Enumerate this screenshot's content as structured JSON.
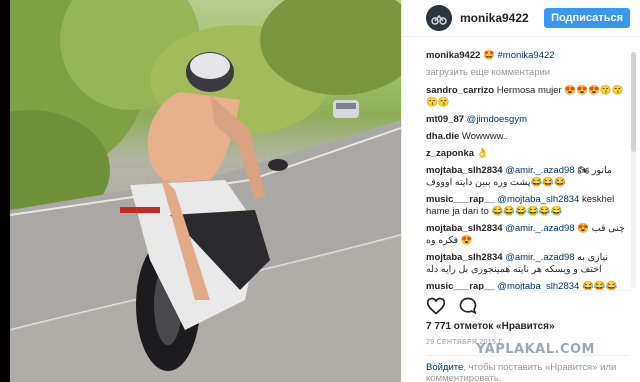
{
  "post": {
    "header_username": "monika9422",
    "follow_label": "Подписаться",
    "caption_user": "monika9422",
    "caption_text": "🤩 #monika9422",
    "load_more": "загрузить еще комментарии",
    "likes": "7 771 отметок «Нравится»",
    "date": "29 СЕНТЯБРЯ 2015 Г.",
    "login_link": "Войдите",
    "login_text": ", чтобы поставить «Нравится» или комментировать."
  },
  "comments": [
    {
      "user": "sandro_carrizo",
      "mention": "",
      "text": "Hermosa mujer 😍😍😍😙😙😙😙",
      "rtl": false
    },
    {
      "user": "mt09_87",
      "mention": "@jimdoesgym",
      "text": "",
      "rtl": false
    },
    {
      "user": "dha.die",
      "mention": "",
      "text": "Wowwww..",
      "rtl": false
    },
    {
      "user": "z_zaponka",
      "mention": "",
      "text": "👌",
      "rtl": false
    },
    {
      "user": "mojtaba_slh2834",
      "mention": "@amir._.azad98",
      "text": "مانور 🏍 پشت وره ببین دایته اوووف😂😂😂",
      "rtl": false
    },
    {
      "user": "music___rap__",
      "mention": "@mojtaba_slh2834",
      "text": "keskhel hame ja dari to 😂😂😂😂😂😂",
      "rtl": false
    },
    {
      "user": "mojtaba_slh2834",
      "mention": "@amir._.azad98",
      "text": "چنی قب 😍 فکره وه 😍",
      "rtl": false
    },
    {
      "user": "mojtaba_slh2834",
      "mention": "@amir._.azad98",
      "text": "نیازی به اختف و ویسکه هر نایته همینجوری بل رایه دله",
      "rtl": false
    },
    {
      "user": "music___rap__",
      "mention": "@mojtaba_slh2834",
      "text": "😂😂😂",
      "rtl": false
    }
  ],
  "watermark": "YAPLAKAL.COM",
  "icons": {
    "like": "heart-outline-icon",
    "comment": "speech-bubble-icon"
  }
}
